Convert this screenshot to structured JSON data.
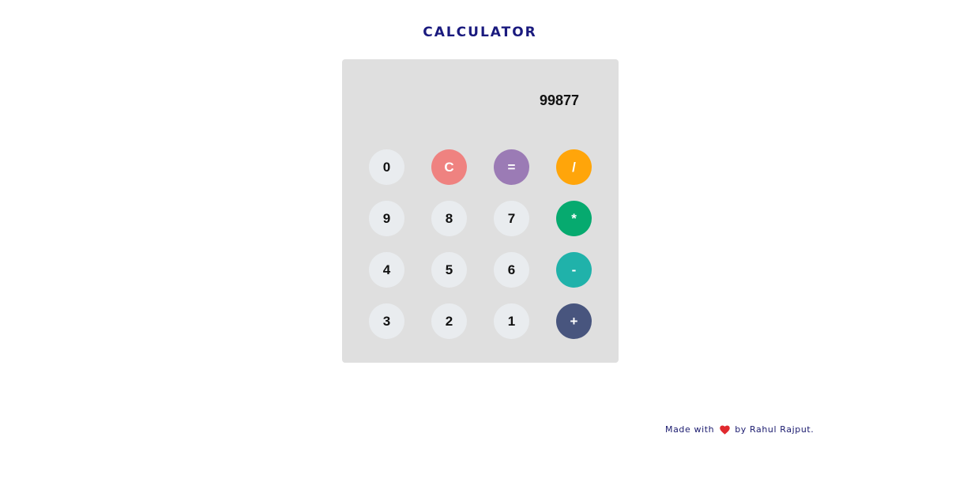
{
  "header": {
    "title": "CALCULATOR"
  },
  "calculator": {
    "display_value": "99877",
    "buttons": [
      {
        "label": "0",
        "name": "digit-0-button",
        "color": "#e9ecef"
      },
      {
        "label": "C",
        "name": "clear-button",
        "color": "#ef8280"
      },
      {
        "label": "=",
        "name": "equals-button",
        "color": "#9b7bb5"
      },
      {
        "label": "/",
        "name": "divide-button",
        "color": "#ffa50a"
      },
      {
        "label": "9",
        "name": "digit-9-button",
        "color": "#e9ecef"
      },
      {
        "label": "8",
        "name": "digit-8-button",
        "color": "#e9ecef"
      },
      {
        "label": "7",
        "name": "digit-7-button",
        "color": "#e9ecef"
      },
      {
        "label": "*",
        "name": "multiply-button",
        "color": "#06aa6f"
      },
      {
        "label": "4",
        "name": "digit-4-button",
        "color": "#e9ecef"
      },
      {
        "label": "5",
        "name": "digit-5-button",
        "color": "#e9ecef"
      },
      {
        "label": "6",
        "name": "digit-6-button",
        "color": "#e9ecef"
      },
      {
        "label": "-",
        "name": "subtract-button",
        "color": "#20b2aa"
      },
      {
        "label": "3",
        "name": "digit-3-button",
        "color": "#e9ecef"
      },
      {
        "label": "2",
        "name": "digit-2-button",
        "color": "#e9ecef"
      },
      {
        "label": "1",
        "name": "digit-1-button",
        "color": "#e9ecef"
      },
      {
        "label": "+",
        "name": "add-button",
        "color": "#48557e"
      }
    ]
  },
  "footer": {
    "prefix": "Made with",
    "icon": "heart-icon",
    "suffix": "by Rahul Rajput."
  }
}
